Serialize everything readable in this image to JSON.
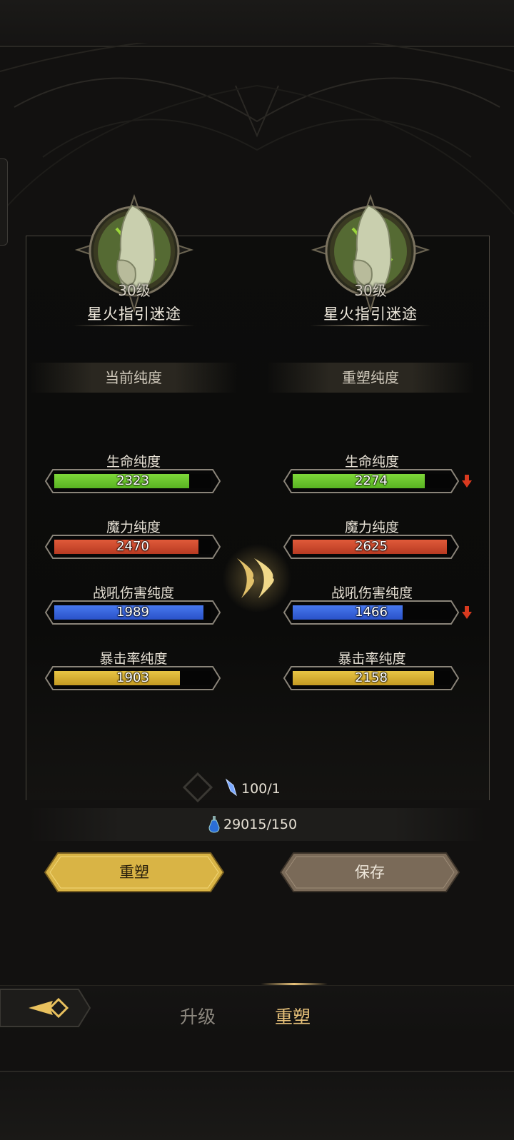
{
  "left": {
    "level": "30级",
    "name": "星火指引迷途",
    "header": "当前纯度",
    "stats": [
      {
        "label": "生命纯度",
        "value": "2323",
        "fill": 0.86
      },
      {
        "label": "魔力纯度",
        "value": "2470",
        "fill": 0.92
      },
      {
        "label": "战吼伤害纯度",
        "value": "1989",
        "fill": 0.95
      },
      {
        "label": "暴击率纯度",
        "value": "1903",
        "fill": 0.8
      }
    ]
  },
  "right": {
    "level": "30级",
    "name": "星火指引迷途",
    "header": "重塑纯度",
    "stats": [
      {
        "label": "生命纯度",
        "value": "2274",
        "fill": 0.84,
        "decrease": true
      },
      {
        "label": "魔力纯度",
        "value": "2625",
        "fill": 0.98,
        "decrease": false
      },
      {
        "label": "战吼伤害纯度",
        "value": "1466",
        "fill": 0.7,
        "decrease": true
      },
      {
        "label": "暴击率纯度",
        "value": "2158",
        "fill": 0.9,
        "decrease": false
      }
    ]
  },
  "costs": {
    "item_cost": "100/1",
    "potion_cost": "29015/150"
  },
  "buttons": {
    "reforge": "重塑",
    "save": "保存"
  },
  "tabs": {
    "upgrade": "升级",
    "reforge": "重塑"
  },
  "icons": [
    "emblem-icon",
    "double-chevron-icon",
    "down-arrow-icon",
    "crystal-icon",
    "potion-icon",
    "diamond-icon",
    "back-arrow-icon"
  ],
  "colors": {
    "life": "#6fcf33",
    "mana": "#d4482e",
    "warcry": "#3a66e0",
    "crit": "#dcb535",
    "decrease": "#d93a1f",
    "gold_button": "#d9b445",
    "active_tab": "#e8c27a"
  }
}
